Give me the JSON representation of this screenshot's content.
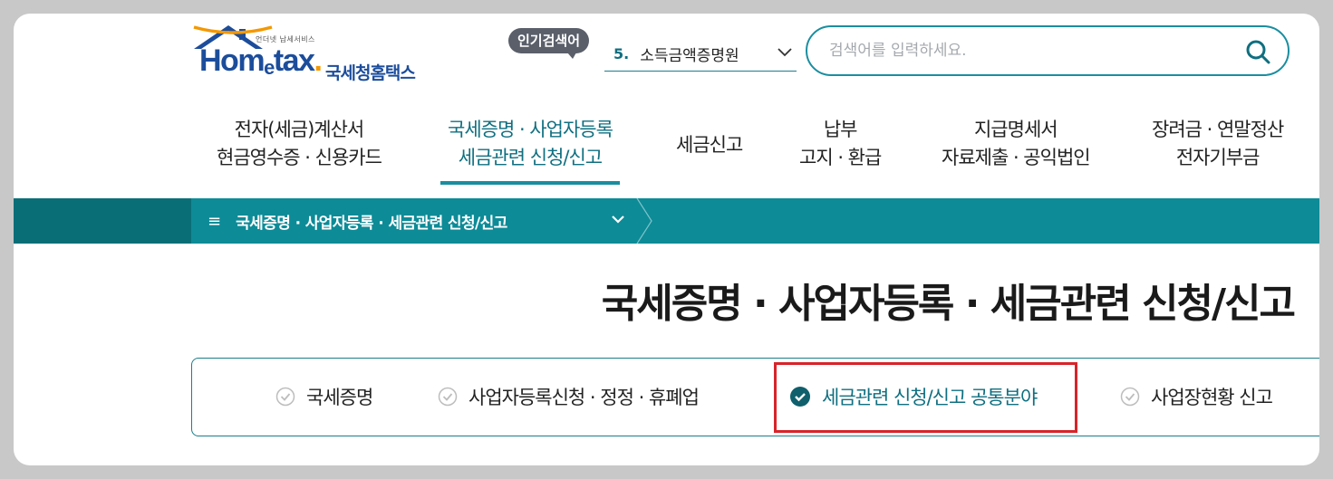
{
  "brand": {
    "tagline": "언더넷 납세서비스",
    "name_en_pre": "Hom",
    "name_en_e": "e",
    "name_en_post": "tax",
    "name_kr": "국세청홈택스"
  },
  "popular_search": {
    "badge": "인기검색어",
    "rank": "5.",
    "keyword": "소득금액증명원"
  },
  "search": {
    "placeholder": "검색어를 입력하세요."
  },
  "gnb": [
    {
      "line1": "전자(세금)계산서",
      "line2": "현금영수증 · 신용카드"
    },
    {
      "line1": "국세증명 · 사업자등록",
      "line2": "세금관련 신청/신고"
    },
    {
      "line1": "세금신고",
      "line2": ""
    },
    {
      "line1": "납부",
      "line2": "고지 · 환급"
    },
    {
      "line1": "지급명세서",
      "line2": "자료제출 · 공익법인"
    },
    {
      "line1": "장려금 · 연말정산",
      "line2": "전자기부금"
    }
  ],
  "location": {
    "menu_glyph": "≡",
    "current": "국세증명 · 사업자등록 · 세금관련 신청/신고"
  },
  "page_title": "국세증명 · 사업자등록 · 세금관련 신청/신고",
  "tabs": [
    {
      "label": "국세증명",
      "active": false
    },
    {
      "label": "사업자등록신청 · 정정 · 휴폐업",
      "active": false
    },
    {
      "label": "세금관련 신청/신고 공통분야",
      "active": true
    },
    {
      "label": "사업장현황 신고",
      "active": false
    }
  ],
  "colors": {
    "accent": "#0d8b97",
    "accent_dark": "#0a6e77",
    "highlight": "#d7242a",
    "brand_blue": "#1c4d9b",
    "brand_orange": "#f39800"
  }
}
